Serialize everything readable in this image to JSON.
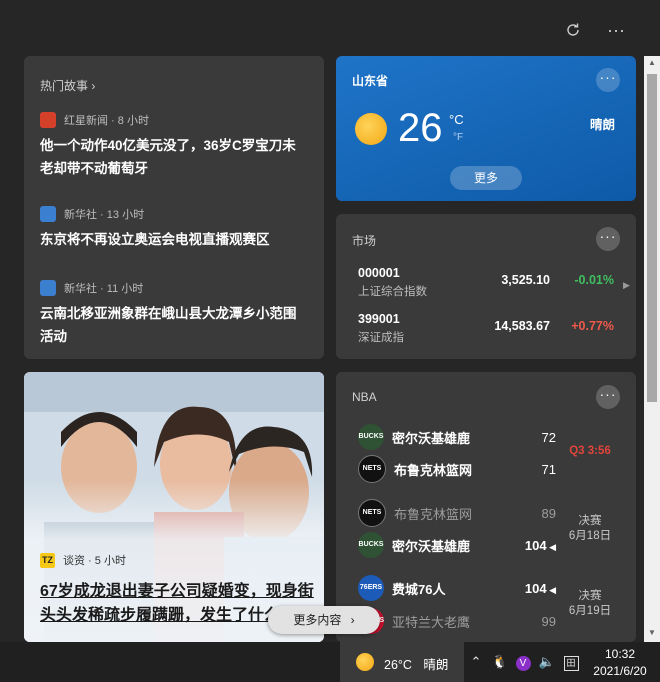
{
  "topbar": {
    "refresh_icon": "refresh-icon",
    "more_icon": "more-icon"
  },
  "hot_stories": {
    "header": "热门故事",
    "stories": [
      {
        "source": "红星新闻 · 8 小时",
        "title": "他一个动作40亿美元没了，36岁C罗宝刀未老却带不动葡萄牙",
        "logo_color": "#d4402a"
      },
      {
        "source": "新华社 · 13 小时",
        "title": "东京将不再设立奥运会电视直播观赛区",
        "logo_color": "#3b7fd0"
      },
      {
        "source": "新华社 · 11 小时",
        "title": "云南北移亚洲象群在峨山县大龙潭乡小范围活动",
        "logo_color": "#3b7fd0"
      }
    ]
  },
  "weather": {
    "location": "山东省",
    "temperature": "26",
    "unit_c": "°C",
    "unit_f": "°F",
    "condition": "晴朗",
    "more_label": "更多"
  },
  "market": {
    "header": "市场",
    "rows": [
      {
        "code": "000001",
        "name": "上证综合指数",
        "price": "3,525.10",
        "change": "-0.01%",
        "change_color": "#3fbf60"
      },
      {
        "code": "399001",
        "name": "深证成指",
        "price": "14,583.67",
        "change": "+0.77%",
        "change_color": "#f05a4a"
      }
    ]
  },
  "photo_story": {
    "source": "谈资 · 5 小时",
    "logo_text": "TZ",
    "title": "67岁成龙退出妻子公司疑婚变，现身街头头发稀疏步履蹒跚，发生了什么事?"
  },
  "nba": {
    "header": "NBA",
    "games": [
      {
        "status_line1": "Q3 3:56",
        "status_line2": "",
        "status_color": "#e0453a",
        "teams": [
          {
            "name": "密尔沃基雄鹿",
            "score": "72",
            "logo": "BUCKS",
            "logo_color": "#2f5234",
            "bold": true,
            "dim": false,
            "winner": false
          },
          {
            "name": "布鲁克林篮网",
            "score": "71",
            "logo": "NETS",
            "logo_color": "#111111",
            "bold": true,
            "dim": false,
            "winner": false
          }
        ]
      },
      {
        "status_line1": "决赛",
        "status_line2": "6月18日",
        "status_color": "#c8c8c8",
        "teams": [
          {
            "name": "布鲁克林篮网",
            "score": "89",
            "logo": "NETS",
            "logo_color": "#111111",
            "bold": false,
            "dim": true,
            "winner": false
          },
          {
            "name": "密尔沃基雄鹿",
            "score": "104",
            "logo": "BUCKS",
            "logo_color": "#2f5234",
            "bold": true,
            "dim": false,
            "winner": true
          }
        ]
      },
      {
        "status_line1": "决赛",
        "status_line2": "6月19日",
        "status_color": "#c8c8c8",
        "teams": [
          {
            "name": "费城76人",
            "score": "104",
            "logo": "76ERS",
            "logo_color": "#1d5bb8",
            "bold": true,
            "dim": false,
            "winner": true
          },
          {
            "name": "亚特兰大老鹰",
            "score": "99",
            "logo": "HAWKS",
            "logo_color": "#c8102e",
            "bold": false,
            "dim": true,
            "winner": false
          }
        ]
      }
    ]
  },
  "more_content_label": "更多内容",
  "taskbar": {
    "weather_temp": "26°C",
    "weather_condition": "晴朗",
    "time": "10:32",
    "date": "2021/6/20"
  }
}
